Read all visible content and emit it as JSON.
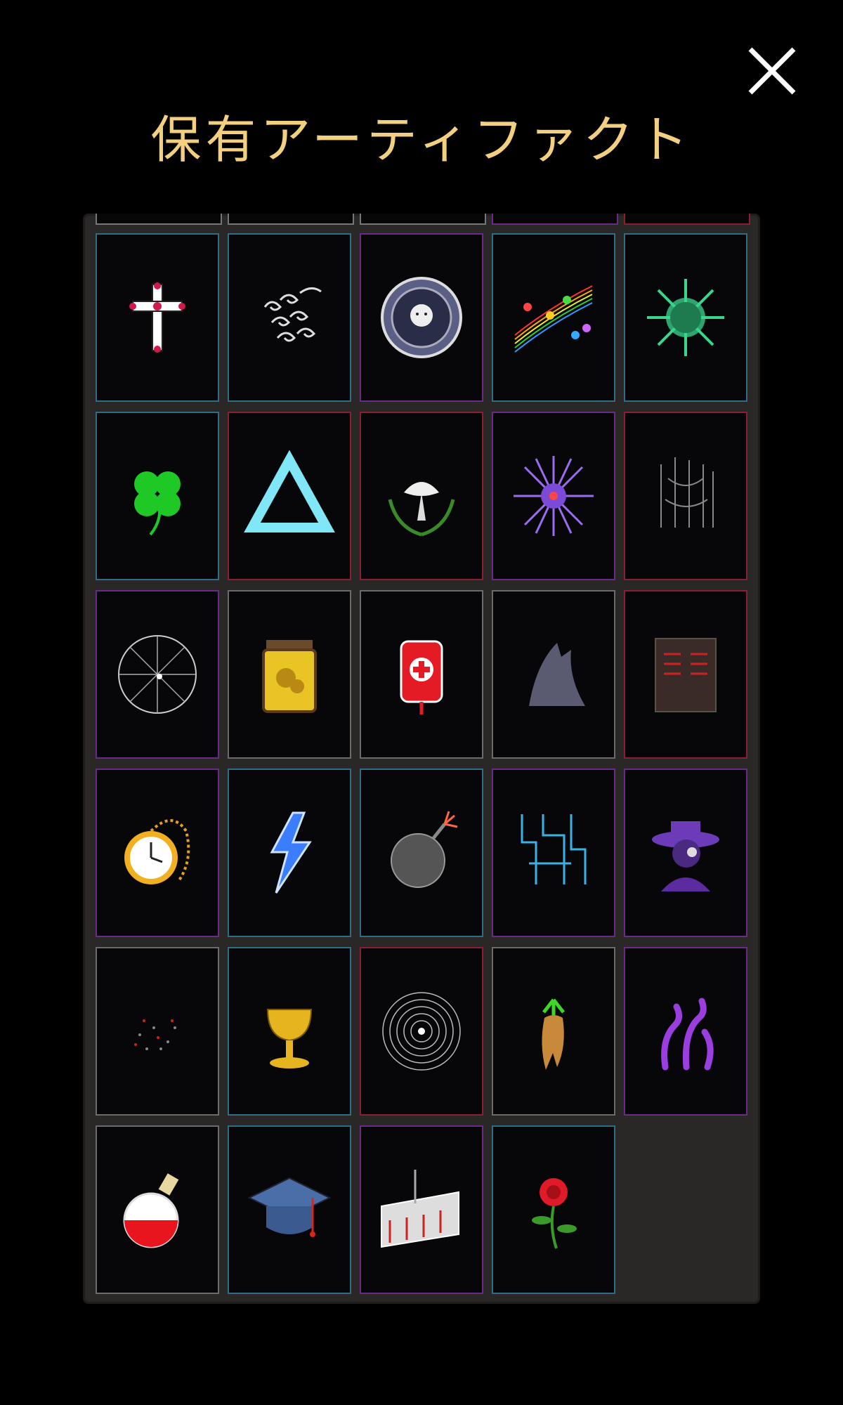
{
  "title": "保有アーティファクト",
  "close_icon": "close-x-icon",
  "colors": {
    "title": "#f3cf80",
    "rarity_blue": "#2f6d86",
    "rarity_red": "#8a1f32",
    "rarity_purple": "#6a2a86",
    "rarity_gray": "#6b6b6b"
  },
  "artifacts": [
    {
      "icon": "holy-cross-icon",
      "rarity": "blue"
    },
    {
      "icon": "wind-swirl-icon",
      "rarity": "blue"
    },
    {
      "icon": "sun-medallion-icon",
      "rarity": "purple"
    },
    {
      "icon": "music-notes-icon",
      "rarity": "blue"
    },
    {
      "icon": "virus-icon",
      "rarity": "blue"
    },
    {
      "icon": "four-leaf-clover-icon",
      "rarity": "blue"
    },
    {
      "icon": "triangle-icon",
      "rarity": "red"
    },
    {
      "icon": "dove-laurel-icon",
      "rarity": "red"
    },
    {
      "icon": "purple-spike-orb-icon",
      "rarity": "purple"
    },
    {
      "icon": "shadow-figure-icon",
      "rarity": "red"
    },
    {
      "icon": "cracked-sphere-icon",
      "rarity": "purple"
    },
    {
      "icon": "yellow-jar-icon",
      "rarity": "gray"
    },
    {
      "icon": "blood-bag-icon",
      "rarity": "gray"
    },
    {
      "icon": "dark-creature-icon",
      "rarity": "gray"
    },
    {
      "icon": "stone-tablet-icon",
      "rarity": "red"
    },
    {
      "icon": "pocket-watch-icon",
      "rarity": "purple"
    },
    {
      "icon": "lightning-icon",
      "rarity": "blue"
    },
    {
      "icon": "bomb-icon",
      "rarity": "blue"
    },
    {
      "icon": "circuit-icon",
      "rarity": "purple"
    },
    {
      "icon": "plague-doctor-icon",
      "rarity": "purple"
    },
    {
      "icon": "red-dust-icon",
      "rarity": "gray"
    },
    {
      "icon": "golden-chalice-icon",
      "rarity": "blue"
    },
    {
      "icon": "vortex-icon",
      "rarity": "red"
    },
    {
      "icon": "mandrake-root-icon",
      "rarity": "gray"
    },
    {
      "icon": "purple-tentacles-icon",
      "rarity": "purple"
    },
    {
      "icon": "red-potion-flask-icon",
      "rarity": "gray"
    },
    {
      "icon": "graduation-cap-icon",
      "rarity": "blue"
    },
    {
      "icon": "ruined-building-icon",
      "rarity": "purple"
    },
    {
      "icon": "red-rose-icon",
      "rarity": "blue"
    }
  ]
}
